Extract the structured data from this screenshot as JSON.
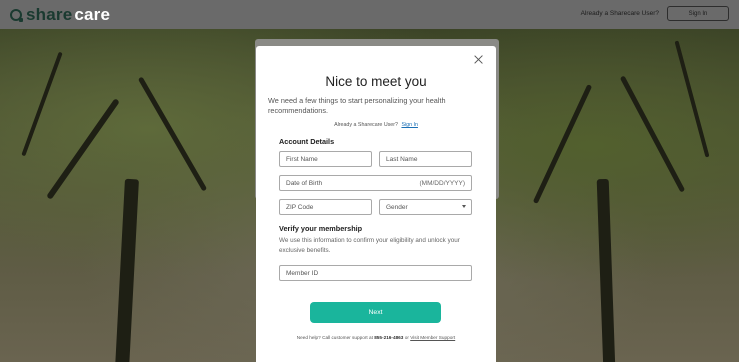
{
  "header": {
    "logo_prefix": "share",
    "logo_suffix": "care",
    "already_text": "Already a Sharecare User?",
    "sign_in_label": "Sign In"
  },
  "modal": {
    "title": "Nice to meet you",
    "subtitle": "We need a few things to start personalizing your health recommendations.",
    "already_text": "Already a Sharecare User?",
    "sign_in_link": "Sign In",
    "account_heading": "Account Details",
    "first_name_placeholder": "First Name",
    "last_name_placeholder": "Last Name",
    "dob_placeholder": "Date of Birth",
    "dob_hint": "(MM/DD/YYYY)",
    "zip_placeholder": "ZIP Code",
    "gender_placeholder": "Gender",
    "membership_heading": "Verify your membership",
    "membership_desc": "We use this information to confirm your eligibility and unlock your exclusive benefits.",
    "member_id_placeholder": "Member ID",
    "next_label": "Next",
    "help_prefix": "Need help? Call customer support at",
    "help_phone": "855-216-4863",
    "help_or": "or",
    "help_link": "Visit Member Support"
  },
  "colors": {
    "accent": "#1ab59c",
    "link": "#1a6fb5"
  }
}
